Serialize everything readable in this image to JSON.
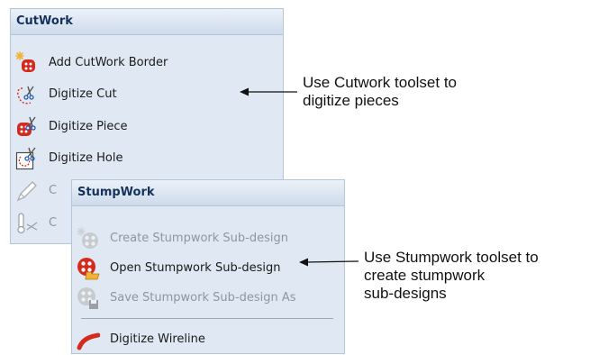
{
  "cutwork": {
    "title": "CutWork",
    "items": [
      {
        "label": "Add CutWork Border",
        "icon": "add-cutwork-border-icon"
      },
      {
        "label": "Digitize Cut",
        "icon": "digitize-cut-icon"
      },
      {
        "label": "Digitize Piece",
        "icon": "digitize-piece-icon"
      },
      {
        "label": "Digitize Hole",
        "icon": "digitize-hole-icon"
      },
      {
        "label": "C",
        "icon": "pen-icon"
      },
      {
        "label": "C",
        "icon": "thermometer-scissors-icon"
      }
    ]
  },
  "stumpwork": {
    "title": "StumpWork",
    "items": [
      {
        "label": "Create Stumpwork Sub-design",
        "icon": "create-stumpwork-icon",
        "enabled": false
      },
      {
        "label": "Open Stumpwork Sub-design",
        "icon": "open-stumpwork-icon",
        "enabled": true
      },
      {
        "label": "Save Stumpwork Sub-design As",
        "icon": "save-stumpwork-icon",
        "enabled": false
      },
      {
        "label": "Digitize Wireline",
        "icon": "wireline-icon",
        "enabled": true
      }
    ]
  },
  "callouts": {
    "cutwork": [
      "Use Cutwork toolset to",
      "digitize pieces"
    ],
    "stumpwork": [
      "Use Stumpwork toolset to",
      "create stumpwork",
      "sub-designs"
    ]
  },
  "colors": {
    "panel_bg": "#dfe8f3",
    "panel_border": "#b4c6dc",
    "header_text": "#15325c",
    "icon_red": "#d42a1e",
    "disabled_text": "#8f969e"
  }
}
